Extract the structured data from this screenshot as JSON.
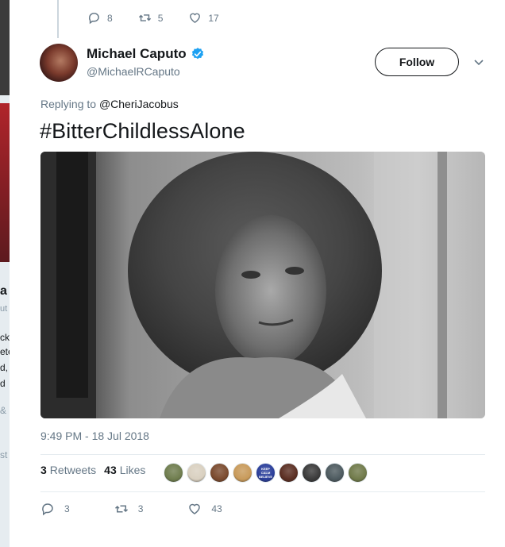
{
  "background": {
    "fragments": [
      "a",
      "ut",
      "ck",
      "ete",
      "d,",
      "d",
      "&",
      "st"
    ]
  },
  "previous_tweet": {
    "replies": "8",
    "retweets": "5",
    "likes": "17"
  },
  "tweet": {
    "author_name": "Michael Caputo",
    "author_handle": "@MichaelRCaputo",
    "verified": true,
    "follow_label": "Follow",
    "replying_prefix": "Replying to",
    "replying_to": "@CheriJacobus",
    "text": "#BitterChildlessAlone",
    "timestamp": "9:49 PM - 18 Jul 2018",
    "retweet_count": "3",
    "retweet_label": "Retweets",
    "like_count": "43",
    "like_label": "Likes",
    "likers": [
      {
        "color": "#6f7d4e"
      },
      {
        "color": "#d9d0c0"
      },
      {
        "color": "#7a4a2e"
      },
      {
        "color": "#c89a5a"
      },
      {
        "color": "#2a3e9a",
        "text": "KEEP CALM BELIEVE"
      },
      {
        "color": "#5a2e22"
      },
      {
        "color": "#3a3a3a"
      },
      {
        "color": "#4d5a5f"
      },
      {
        "color": "#707a4a"
      }
    ],
    "actions": {
      "replies": "3",
      "retweets": "3",
      "likes": "43"
    }
  },
  "colors": {
    "verified_blue": "#1da1f2",
    "text_primary": "#14171a",
    "text_secondary": "#657786"
  }
}
